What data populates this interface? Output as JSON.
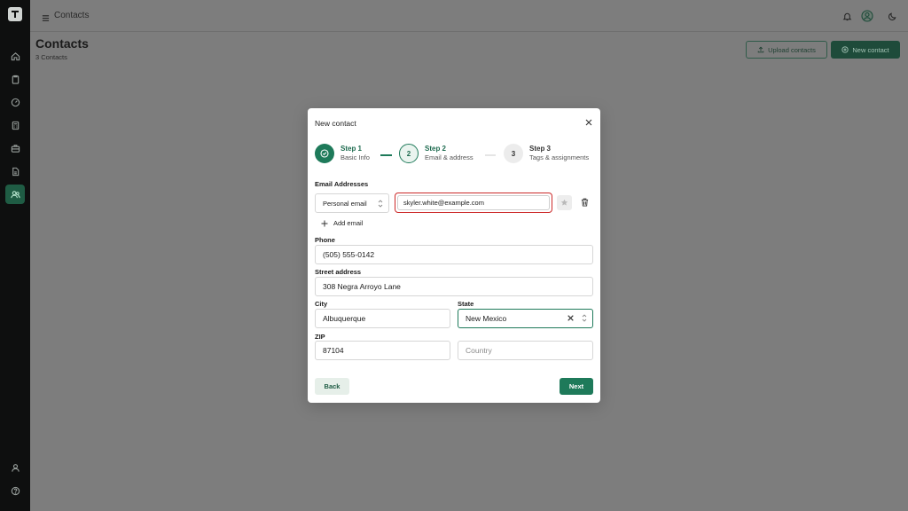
{
  "topbar": {
    "breadcrumb": "Contacts"
  },
  "page": {
    "title": "Contacts",
    "subtitle": "3 Contacts",
    "upload_label": "Upload contacts",
    "new_label": "New contact"
  },
  "modal": {
    "title": "New contact",
    "steps": [
      {
        "title": "Step 1",
        "subtitle": "Basic Info",
        "state": "done"
      },
      {
        "number": "2",
        "title": "Step 2",
        "subtitle": "Email & address",
        "state": "active"
      },
      {
        "number": "3",
        "title": "Step 3",
        "subtitle": "Tags & assignments",
        "state": "pending"
      }
    ],
    "email_section_label": "Email Addresses",
    "email_type": "Personal email",
    "email_value": "skyler.white@example.com",
    "add_email_label": "Add email",
    "phone_label": "Phone",
    "phone_value": "(505) 555-0142",
    "street_label": "Street address",
    "street_value": "308 Negra Arroyo Lane",
    "city_label": "City",
    "city_value": "Albuquerque",
    "state_label": "State",
    "state_value": "New Mexico",
    "zip_label": "ZIP",
    "zip_value": "87104",
    "country_placeholder": "Country",
    "back_label": "Back",
    "next_label": "Next"
  },
  "colors": {
    "accent": "#1e7a5a",
    "error_outline": "#cc2a2a",
    "overlay": "#7d7d7d",
    "rail": "#0e0f0f"
  }
}
